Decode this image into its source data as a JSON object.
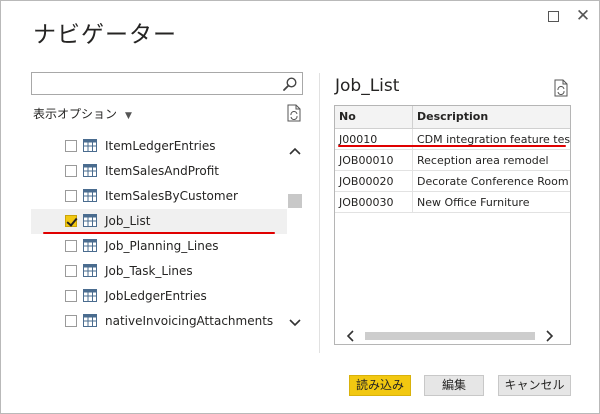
{
  "window": {
    "title": "ナビゲーター"
  },
  "search": {
    "value": "",
    "placeholder": ""
  },
  "left_panel": {
    "display_options_label": "表示オプション",
    "items": [
      {
        "label": "ItemLedgerEntries",
        "checked": false,
        "selected": false
      },
      {
        "label": "ItemSalesAndProfit",
        "checked": false,
        "selected": false
      },
      {
        "label": "ItemSalesByCustomer",
        "checked": false,
        "selected": false
      },
      {
        "label": "Job_List",
        "checked": true,
        "selected": true
      },
      {
        "label": "Job_Planning_Lines",
        "checked": false,
        "selected": false
      },
      {
        "label": "Job_Task_Lines",
        "checked": false,
        "selected": false
      },
      {
        "label": "JobLedgerEntries",
        "checked": false,
        "selected": false
      },
      {
        "label": "nativeInvoicingAttachments",
        "checked": false,
        "selected": false
      }
    ]
  },
  "preview": {
    "title": "Job_List",
    "columns": [
      "No",
      "Description"
    ],
    "rows": [
      [
        "J00010",
        "CDM integration feature test"
      ],
      [
        "JOB00010",
        "Reception area remodel"
      ],
      [
        "JOB00020",
        "Decorate Conference Room"
      ],
      [
        "JOB00030",
        "New Office Furniture"
      ]
    ]
  },
  "buttons": {
    "load": "読み込み",
    "edit": "編集",
    "cancel": "キャンセル"
  },
  "colors": {
    "accent_yellow": "#f2c811",
    "annotation_red": "#e00000",
    "selected_row": "#f0f0f0"
  }
}
